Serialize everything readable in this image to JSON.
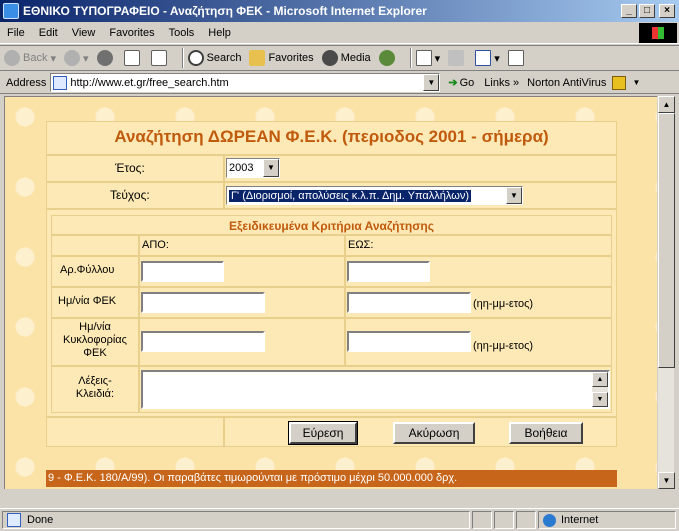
{
  "window": {
    "title": "ΕΘΝΙΚΟ ΤΥΠΟΓΡΑΦΕΙΟ - Αναζήτηση ΦΕΚ - Microsoft Internet Explorer",
    "min": "_",
    "max": "□",
    "close": "×"
  },
  "menu": [
    "File",
    "Edit",
    "View",
    "Favorites",
    "Tools",
    "Help"
  ],
  "toolbar": {
    "back": "Back",
    "search": "Search",
    "favorites": "Favorites",
    "media": "Media"
  },
  "address": {
    "label": "Address",
    "url": "http://www.et.gr/free_search.htm",
    "go": "Go",
    "links": "Links",
    "norton": "Norton AntiVirus"
  },
  "page": {
    "heading": "Αναζήτηση  ΔΩΡΕΑΝ  Φ.Ε.Κ. (περιοδος 2001 - σήμερα)",
    "year_label": "Έτος:",
    "year_value": "2003",
    "issue_label": "Τεύχος:",
    "issue_value": "Γ' (Διορισμοί, απολύσεις κ.λ.π. Δημ. Υπαλλήλων)",
    "advanced_heading": "Εξειδικευμένα Κριτήρια Αναζήτησης",
    "from_label": "ΑΠΟ:",
    "to_label": "ΕΩΣ:",
    "sheet_label": "Αρ.Φύλλου",
    "date_label": "Ημ/νία ΦΕΚ",
    "circ_label_1": "Ημ/νία",
    "circ_label_2": "Κυκλοφορίας",
    "circ_label_3": "ΦΕΚ",
    "keywords_label_1": "Λέξεις-",
    "keywords_label_2": "Κλειδιά:",
    "date_hint": "(ηη-μμ-ετος)",
    "search_button": "Εύρεση",
    "cancel_button": "Ακύρωση",
    "help_button": "Βοήθεια",
    "marquee": "9 - Φ.Ε.Κ. 180/Α/99). Οι παραβάτες τιμωρούνται με πρόστιμο μέχρι 50.000.000 δρχ."
  },
  "status": {
    "text": "Done",
    "zone": "Internet"
  }
}
